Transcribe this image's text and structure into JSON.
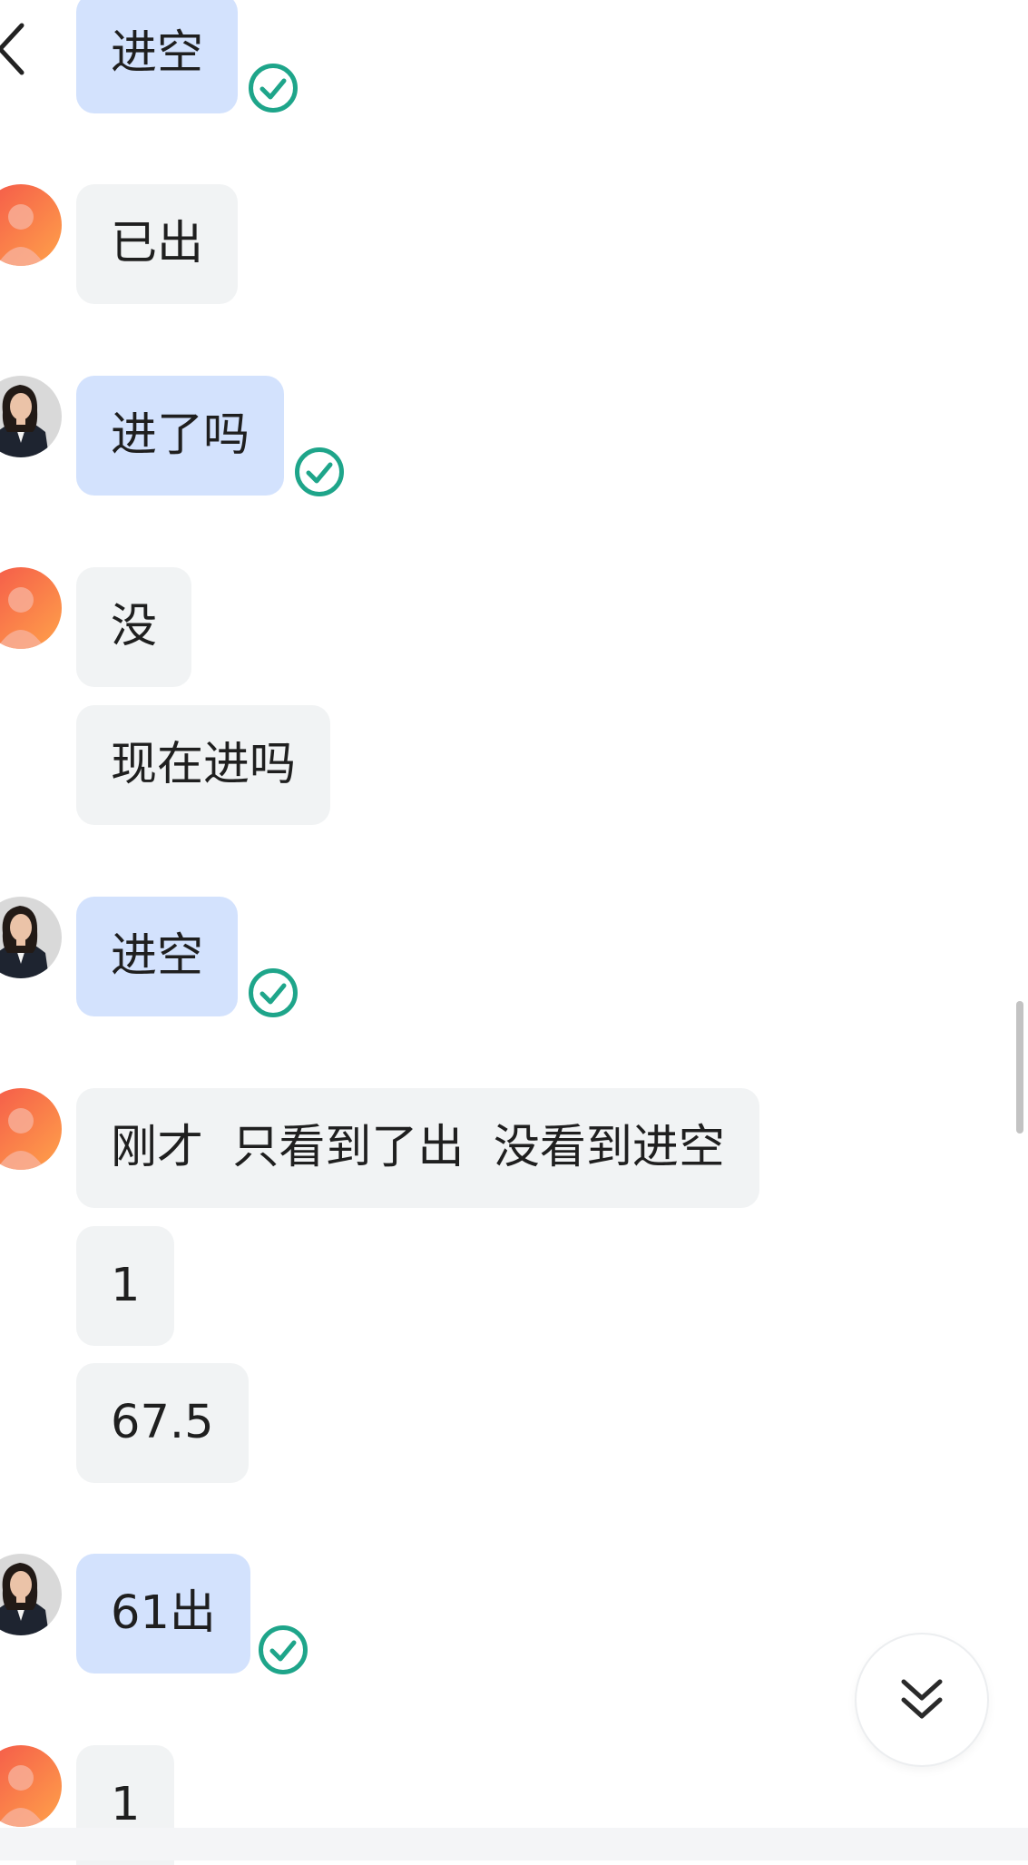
{
  "header": {
    "back_icon": "chevron-left-icon"
  },
  "messages": [
    {
      "sender": "me",
      "text": "进空",
      "status": "read-check-icon"
    },
    {
      "sender": "other",
      "text": "已出"
    },
    {
      "sender": "me",
      "text": "进了吗",
      "status": "read-check-icon"
    },
    {
      "sender": "other",
      "text": "没"
    },
    {
      "sender": "other",
      "text": "现在进吗"
    },
    {
      "sender": "me",
      "text": "进空",
      "status": "read-check-icon"
    },
    {
      "sender": "other",
      "text": "刚才  只看到了出  没看到进空"
    },
    {
      "sender": "other",
      "text": "1"
    },
    {
      "sender": "other",
      "text": "67.5"
    },
    {
      "sender": "me",
      "text": "61出",
      "status": "read-check-icon"
    },
    {
      "sender": "other",
      "text": "1"
    }
  ],
  "controls": {
    "scroll_to_bottom_icon": "double-chevron-down-icon"
  },
  "colors": {
    "my_bubble": "#d3e2fd",
    "their_bubble": "#f1f3f4",
    "read_check": "#1ea58a",
    "text": "#1f1f1f"
  }
}
